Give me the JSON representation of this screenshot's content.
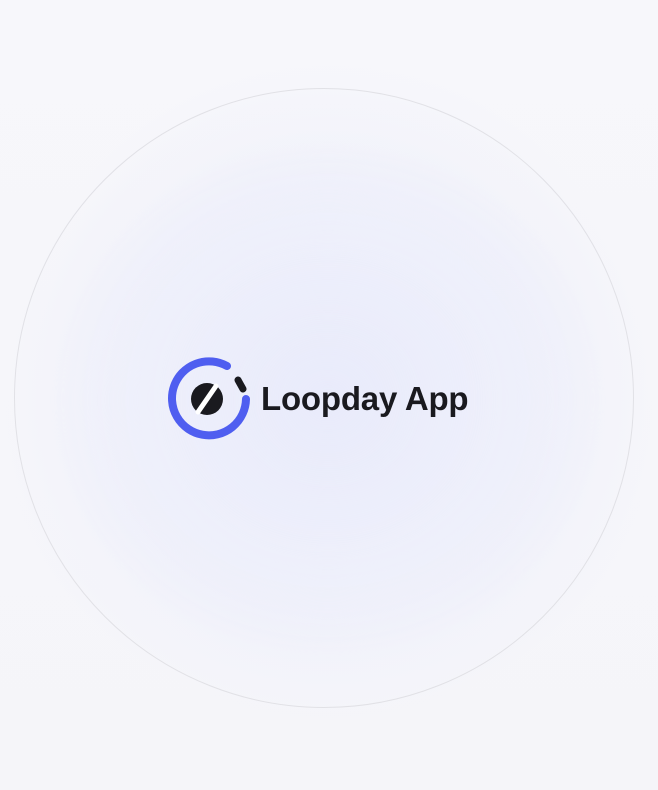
{
  "app": {
    "name": "Loopday App",
    "logo_icon": "loopday-logo-icon"
  },
  "colors": {
    "background": "#f6f6fa",
    "accent": "#4f5ef0",
    "text": "#1a1a1f",
    "ring": "#e1e1e6"
  }
}
